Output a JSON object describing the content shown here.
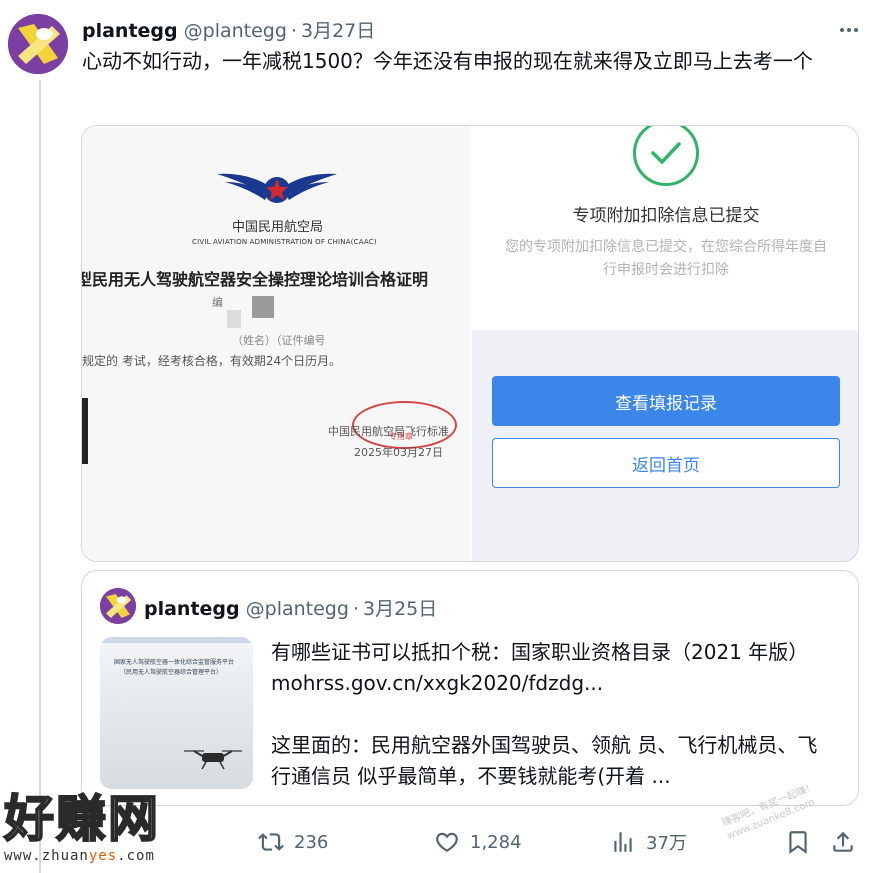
{
  "tweet": {
    "author_name": "plantegg",
    "author_handle": "@plantegg",
    "separator": "·",
    "date": "3月27日",
    "text": "心动不如行动，一年减税1500？今年还没有申报的现在就来得及立即马上去考一个"
  },
  "certificate": {
    "org_cn": "中国民用航空局",
    "org_en": "CIVIL AVIATION ADMINISTRATION OF CHINA(CAAC)",
    "title": "型民用无人驾驶航空器安全操控理论培训合格证明",
    "number_label": "编",
    "name_label": "（姓名）（证件编号",
    "body": "规定的      考试，经考核合格，有效期24个日历月。",
    "issuer": "中国民用航空局飞行标准",
    "date": "2025年03月27日",
    "stamp_text": "专用章",
    "stamp_ring_text": "全操控理论培训合格证"
  },
  "submission": {
    "title": "专项附加扣除信息已提交",
    "description": "您的专项附加扣除信息已提交，在您综合所得年度自行申报时会进行扣除",
    "primary_button": "查看填报记录",
    "secondary_button": "返回首页",
    "success_color": "#2fb569",
    "accent_color": "#3a86e9"
  },
  "quoted_tweet": {
    "author_name": "plantegg",
    "author_handle": "@plantegg",
    "separator": "·",
    "date": "3月25日",
    "paragraph1": "有哪些证书可以抵扣个税：国家职业资格目录（2021 年版）mohrss.gov.cn/xxgk2020/fdzdg...",
    "paragraph2": "这里面的：民用航空器外国驾驶员、领航 员、飞行机械员、飞行通信员 似乎最简单，不要钱就能考(开着 ...",
    "thumb_line1": "国家无人驾驶航空器一体化综合监管服务平台",
    "thumb_line2": "（民用无人驾驶航空器综合管理平台）",
    "thumb_corner": "Login"
  },
  "actions": {
    "retweets": "236",
    "likes": "1,284",
    "views": "37万"
  },
  "watermark": {
    "logo_text": "好赚网",
    "url_prefix": "www.zhuan",
    "url_highlight": "yes",
    "url_suffix": ".com",
    "diag_line1": "赚客吧，有奖一起赚！",
    "diag_line2": "www.zuanke8.com"
  },
  "icons": {
    "more": "more-icon",
    "retweet": "retweet-icon",
    "like": "heart-icon",
    "views": "views-icon",
    "bookmark": "bookmark-icon",
    "share": "share-icon",
    "check": "check-icon"
  }
}
